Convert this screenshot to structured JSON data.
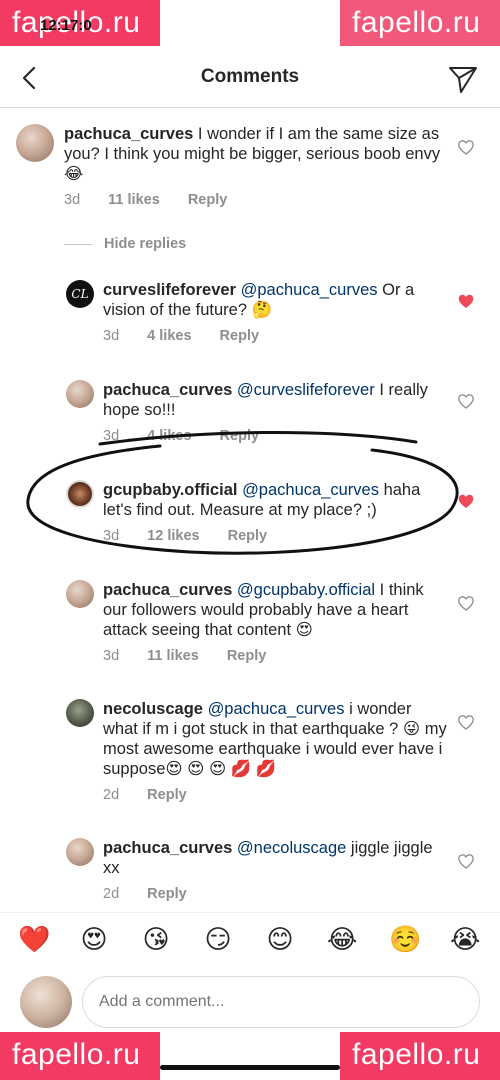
{
  "watermark": "fapello.ru",
  "status": {
    "time": "12:17:0"
  },
  "header": {
    "title": "Comments"
  },
  "hide_replies_label": "Hide replies",
  "comments": [
    {
      "user": "pachuca_curves",
      "mention": "",
      "text": "I wonder if I am the same size as you? I think you might be bigger, serious boob envy 😂",
      "age": "3d",
      "likes": "11 likes",
      "reply": "Reply",
      "liked": false
    },
    {
      "user": "curveslifeforever",
      "mention": "@pachuca_curves",
      "text": "Or a vision of the future? 🤔",
      "age": "3d",
      "likes": "4 likes",
      "reply": "Reply",
      "liked": true,
      "avatar_text": "CL"
    },
    {
      "user": "pachuca_curves",
      "mention": "@curveslifeforever",
      "text": "I really hope so!!!",
      "age": "3d",
      "likes": "4 likes",
      "reply": "Reply",
      "liked": false
    },
    {
      "user": "gcupbaby.official",
      "mention": "@pachuca_curves",
      "text": "haha let's find out. Measure at my place? ;)",
      "age": "3d",
      "likes": "12 likes",
      "reply": "Reply",
      "liked": true
    },
    {
      "user": "pachuca_curves",
      "mention": "@gcupbaby.official",
      "text": "I think our followers would probably have a heart attack seeing that content 😍",
      "age": "3d",
      "likes": "11 likes",
      "reply": "Reply",
      "liked": false
    },
    {
      "user": "necoluscage",
      "mention": "@pachuca_curves",
      "text": "i wonder what if m i got stuck in that earthquake ? 😜 my most awesome earthquake i would ever have i suppose😍 😍 😍 💋 💋",
      "age": "2d",
      "likes": "",
      "reply": "Reply",
      "liked": false
    },
    {
      "user": "pachuca_curves",
      "mention": "@necoluscage",
      "text": "jiggle jiggle xx",
      "age": "2d",
      "likes": "",
      "reply": "Reply",
      "liked": false
    }
  ],
  "emoji_bar": [
    "❤️",
    "😍",
    "😘",
    "😏",
    "😊",
    "😂",
    "☺️",
    "😭"
  ],
  "composer": {
    "placeholder": "Add a comment..."
  },
  "colors": {
    "like_red": "#ed4956",
    "meta_gray": "#8e8e8e",
    "mention_blue": "#003569",
    "watermark_pink": "#f23a62"
  }
}
